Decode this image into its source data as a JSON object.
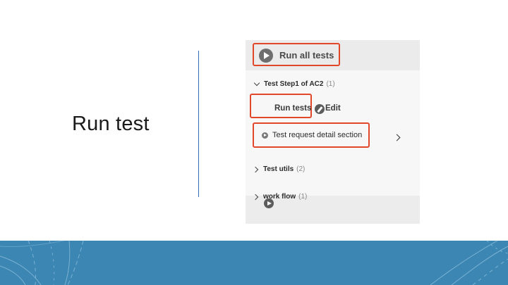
{
  "slide": {
    "title": "Run test"
  },
  "panel": {
    "run_all_label": "Run all tests",
    "groups": [
      {
        "name": "Test Step1 of AC2",
        "count": "(1)",
        "expanded": true,
        "actions": {
          "run_label": "Run tests",
          "edit_label": "Edit"
        },
        "items": [
          {
            "label": "Test request detail section"
          }
        ]
      },
      {
        "name": "Test utils",
        "count": "(2)",
        "expanded": false
      },
      {
        "name": "work flow",
        "count": "(1)",
        "expanded": false
      }
    ]
  },
  "icons": {
    "run_all": "play-circle-icon",
    "run_tests": "play-circle-icon",
    "edit": "pencil-icon",
    "item_run": "play-circle-icon",
    "expand_group": "chevron-down-icon",
    "collapse_group": "chevron-right-icon",
    "open_item": "chevron-right-icon"
  },
  "colors": {
    "highlight": "#e2472a",
    "divider": "#2f6fb1",
    "footer": "#3c86b4"
  }
}
